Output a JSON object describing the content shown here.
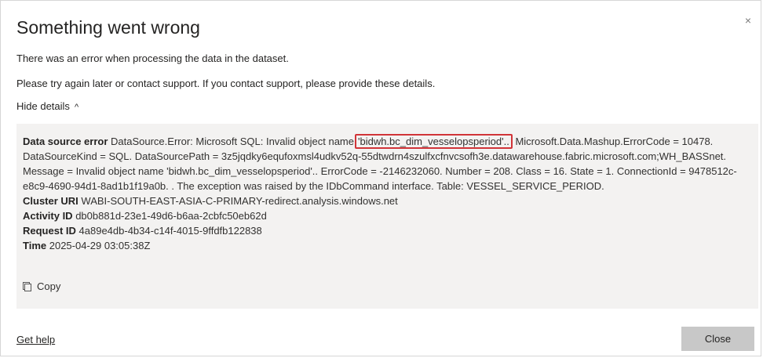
{
  "dialog": {
    "title": "Something went wrong",
    "close_glyph": "×",
    "message": "There was an error when processing the data in the dataset.",
    "support": "Please try again later or contact support. If you contact support, please provide these details.",
    "toggle_label": "Hide details",
    "toggle_glyph": "^"
  },
  "details": {
    "ds_label": "Data source error",
    "ds_prefix": "DataSource.Error: Microsoft SQL: Invalid object name",
    "ds_highlight": "'bidwh.bc_dim_vesselopsperiod'..",
    "ds_rest": "Microsoft.Data.Mashup.ErrorCode = 10478. DataSourceKind = SQL. DataSourcePath = 3z5jqdky6equfoxmsl4udkv52q-55dtwdrn4szulfxcfnvcsofh3e.datawarehouse.fabric.microsoft.com;WH_BASSnet. Message = Invalid object name 'bidwh.bc_dim_vesselopsperiod'.. ErrorCode = -2146232060. Number = 208. Class = 16. State = 1. ConnectionId = 9478512c-e8c9-4690-94d1-8ad1b1f19a0b. . The exception was raised by the IDbCommand interface. Table: VESSEL_SERVICE_PERIOD.",
    "cluster_label": "Cluster URI",
    "cluster_value": "WABI-SOUTH-EAST-ASIA-C-PRIMARY-redirect.analysis.windows.net",
    "activity_label": "Activity ID",
    "activity_value": "db0b881d-23e1-49d6-b6aa-2cbfc50eb62d",
    "request_label": "Request ID",
    "request_value": "4a89e4db-4b34-c14f-4015-9ffdfb122838",
    "time_label": "Time",
    "time_value": "2025-04-29 03:05:38Z",
    "copy_label": "Copy"
  },
  "footer": {
    "get_help": "Get help",
    "close_label": "Close"
  },
  "colors": {
    "highlight_border": "#d13438",
    "details_bg": "#f3f2f1",
    "close_button_bg": "#c8c8c8"
  }
}
